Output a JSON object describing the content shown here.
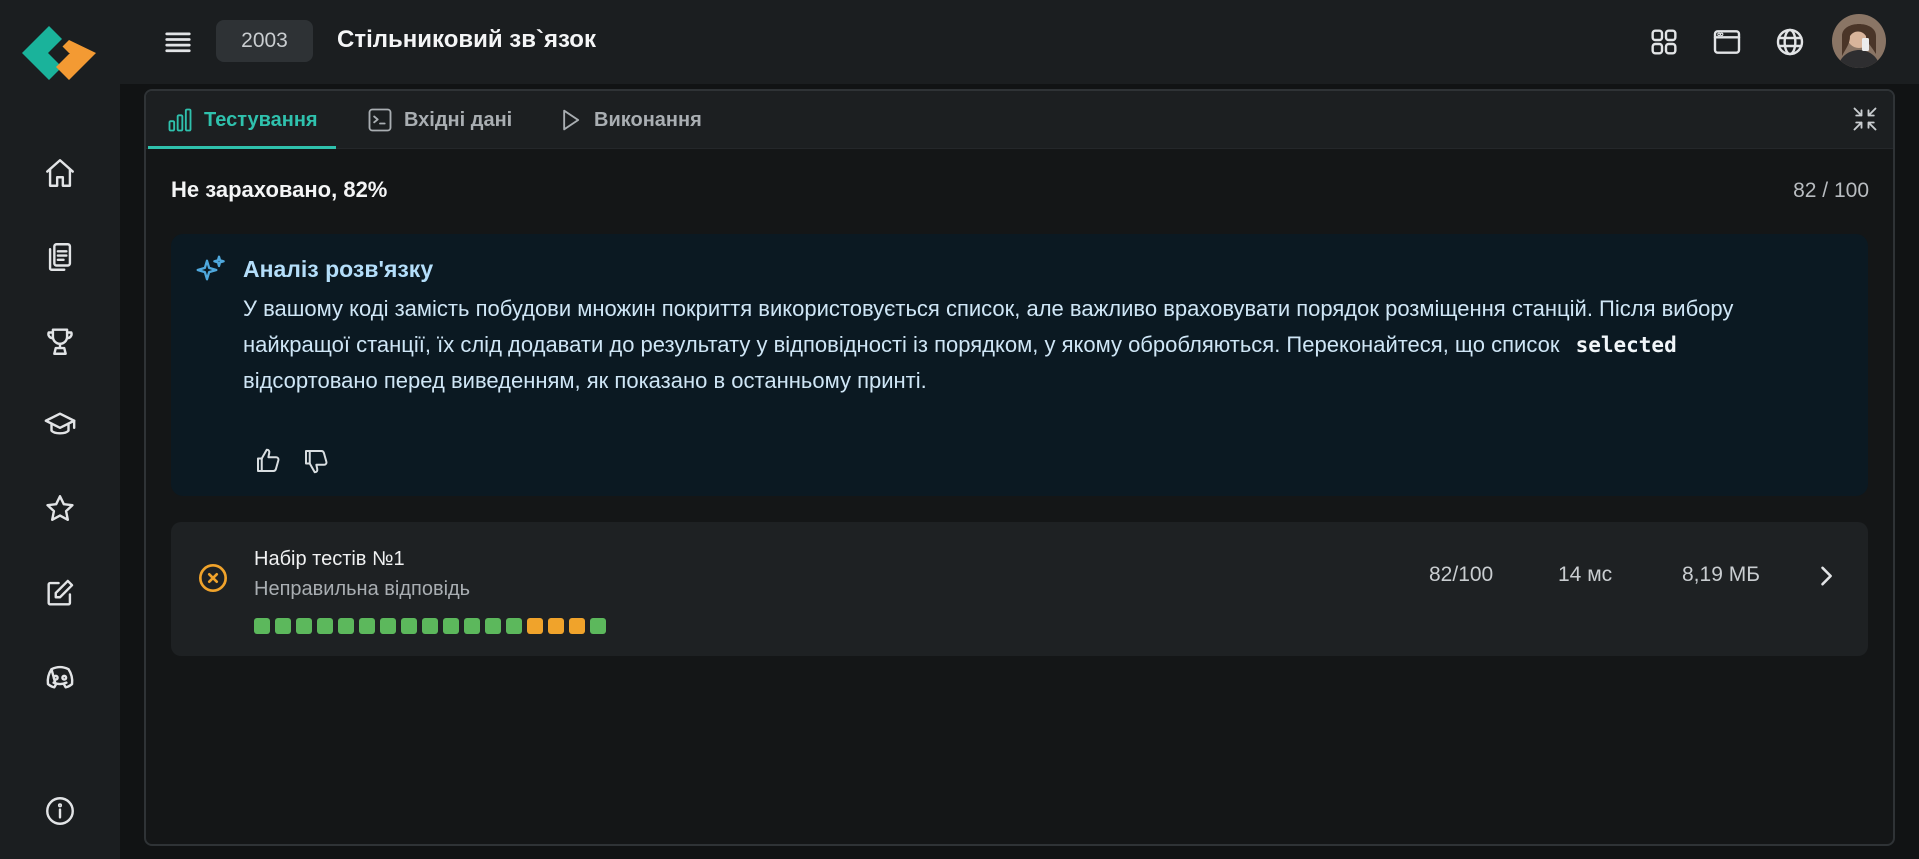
{
  "topbar": {
    "problem_number": "2003",
    "problem_title": "Стільниковий зв`язок"
  },
  "tabs": [
    {
      "label": "Тестування",
      "icon": "bar-chart-icon",
      "active": true
    },
    {
      "label": "Вхідні дані",
      "icon": "terminal-icon",
      "active": false
    },
    {
      "label": "Виконання",
      "icon": "play-icon",
      "active": false
    }
  ],
  "result": {
    "verdict": "Не зараховано, 82%",
    "score": "82 / 100"
  },
  "analysis": {
    "title": "Аналіз розв'язку",
    "text_before": "У вашому коді замість побудови множин покриття використовується список, але важливо враховувати порядок розміщення станцій. Після вибору найкращої станції, їх слід додавати до результату у відповідності із порядком, у якому обробляються. Переконайтеся, що список",
    "code": "selected",
    "text_after": "відсортовано перед виведенням, як показано в останньому принті."
  },
  "testset": {
    "title": "Набір тестів №1",
    "status": "Неправильна відповідь",
    "score": "82/100",
    "time": "14 мс",
    "memory": "8,19 МБ",
    "tests": [
      "pass",
      "pass",
      "pass",
      "pass",
      "pass",
      "pass",
      "pass",
      "pass",
      "pass",
      "pass",
      "pass",
      "pass",
      "pass",
      "fail",
      "fail",
      "fail",
      "pass"
    ]
  },
  "colors": {
    "accent": "#2fc1ad",
    "pass": "#5cb85c",
    "fail": "#f0a32b",
    "analysis_bg": "#0b1922"
  }
}
